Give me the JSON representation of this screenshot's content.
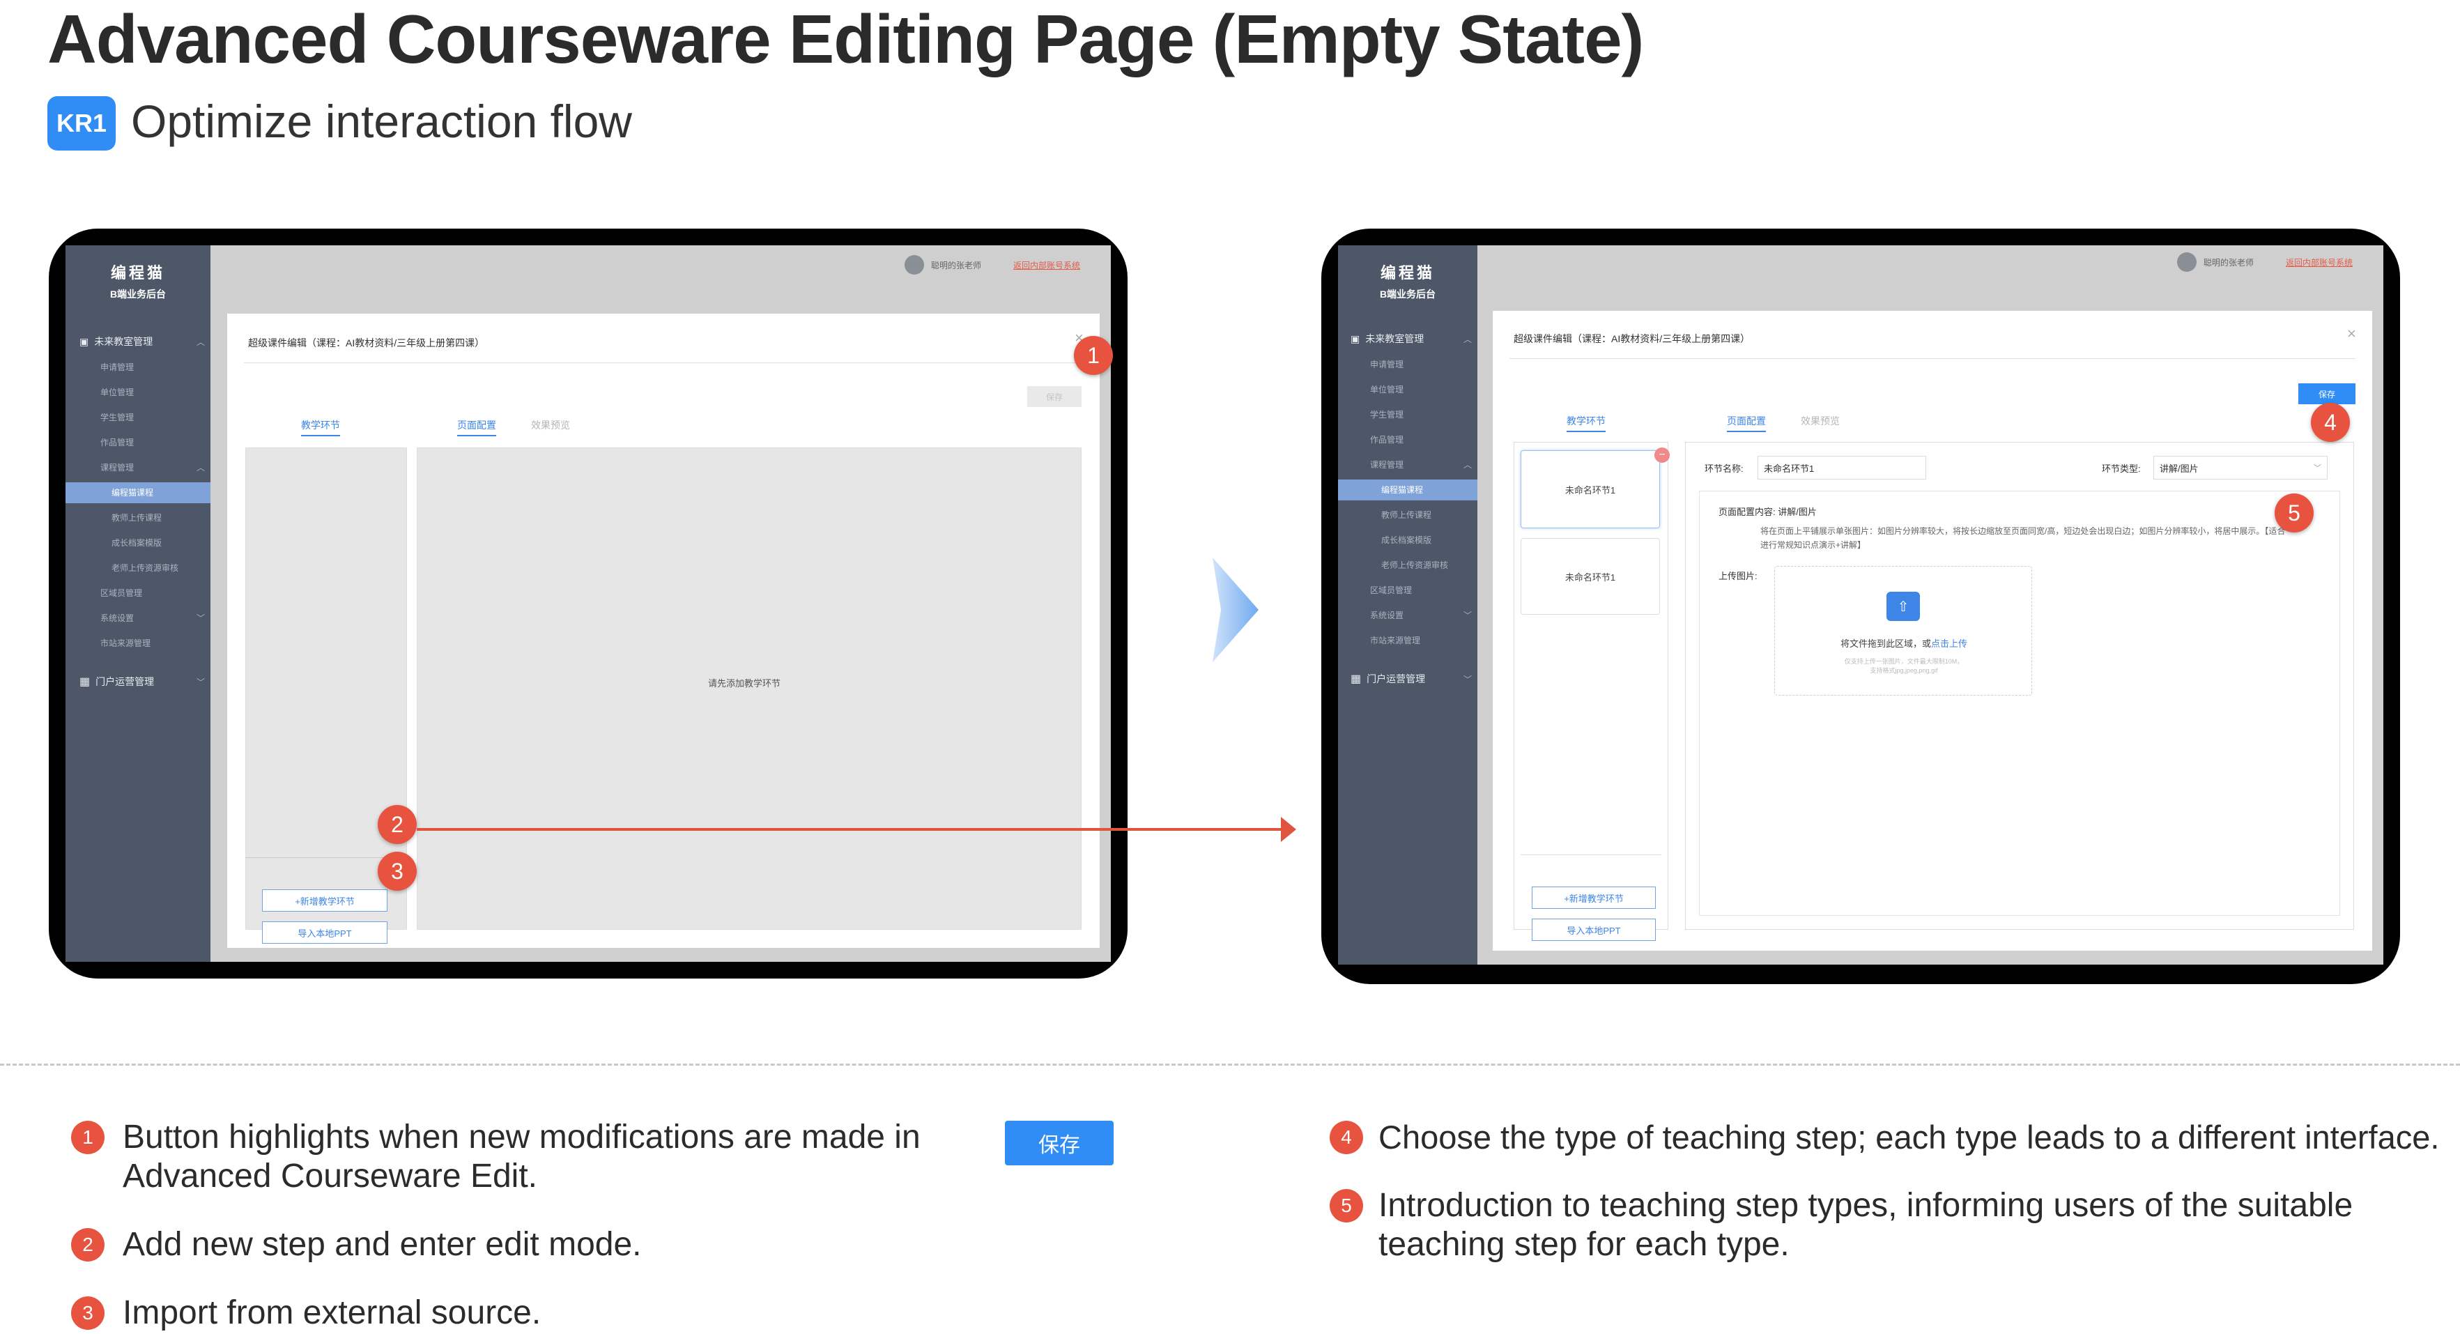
{
  "header": {
    "title": "Advanced Courseware Editing Page (Empty State)",
    "badge": "KR1",
    "subtitle": "Optimize interaction flow"
  },
  "app": {
    "brand_line1": "编程猫",
    "brand_line2": "B端业务后台",
    "user": "聪明的张老师",
    "back_link": "返回内部账号系统",
    "sidebar": {
      "group1": "未来教室管理",
      "items1": [
        "申请管理",
        "单位管理",
        "学生管理",
        "作品管理"
      ],
      "course_group": "课程管理",
      "course_items": [
        "编程猫课程",
        "教师上传课程",
        "成长档案模版",
        "老师上传资源审核"
      ],
      "items2": [
        "区域员管理",
        "系统设置",
        "市站来源管理"
      ],
      "group2": "门户运营管理"
    },
    "dialog_title": "超级课件编辑（课程：AI教材资料/三年级上册第四课）",
    "save": "保存",
    "tab_steps": "教学环节",
    "tab_config": "页面配置",
    "tab_preview": "效果预览",
    "empty_hint": "请先添加教学环节",
    "add_step": "+新增教学环节",
    "import_ppt": "导入本地PPT"
  },
  "edit_state": {
    "step_cards": [
      "未命名环节1",
      "未命名环节1"
    ],
    "step_name_label": "环节名称:",
    "step_name_value": "未命名环节1",
    "step_type_label": "环节类型:",
    "step_type_value": "讲解/图片",
    "config_label": "页面配置内容: 讲解/图片",
    "config_desc": "将在页面上平铺展示单张图片：如图片分辨率较大，将按长边缩放至页面同宽/高，短边处会出现白边；如图片分辨率较小，将居中展示。【适合进行常规知识点演示+讲解】",
    "upload_label": "上传图片:",
    "upload_drag": "将文件拖到此区域，或",
    "upload_click": "点击上传",
    "upload_hint1": "仅支持上传一张图片，文件最大限制10M，",
    "upload_hint2": "支持格式jpg,jpeg,png,gif"
  },
  "markers": [
    "1",
    "2",
    "3",
    "4",
    "5"
  ],
  "notes": {
    "n1": "Button highlights when new modifications are made in Advanced Courseware Edit.",
    "n1_button": "保存",
    "n2": "Add new step and enter edit mode.",
    "n3": "Import from external source.",
    "n4": "Choose the type of teaching step; each type leads to a different interface.",
    "n5": "Introduction to teaching step types, informing users of the suitable teaching step for each type."
  },
  "colors": {
    "accent": "#2f8df5",
    "marker": "#e8533f",
    "sidebar": "#4d5767"
  }
}
